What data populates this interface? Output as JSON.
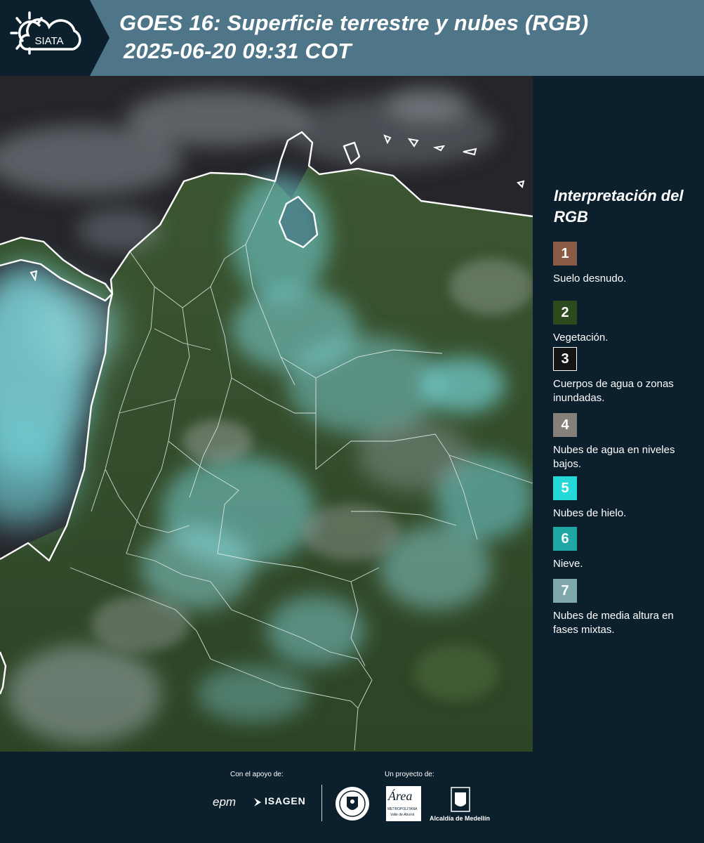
{
  "header": {
    "logo_text": "SIATA",
    "title_line1": "GOES 16: Superficie terrestre y nubes (RGB)",
    "title_line2": "2025-06-20 09:31 COT"
  },
  "legend": {
    "title": "Interpretación del RGB",
    "items": [
      {
        "number": "1",
        "label": "Suelo desnudo.",
        "color": "#8a5b45"
      },
      {
        "number": "2",
        "label": "Vegetación.",
        "color": "#2b4a1e"
      },
      {
        "number": "3",
        "label": "Cuerpos de agua o zonas inundadas.",
        "color": "#141414"
      },
      {
        "number": "4",
        "label": "Nubes de agua en niveles bajos.",
        "color": "#86807a"
      },
      {
        "number": "5",
        "label": "Nubes de hielo.",
        "color": "#25d9d9"
      },
      {
        "number": "6",
        "label": "Nieve.",
        "color": "#21a6a6"
      },
      {
        "number": "7",
        "label": "Nubes de media altura en fases mixtas.",
        "color": "#7fa8aa"
      }
    ]
  },
  "footer": {
    "support_label": "Con el apoyo de:",
    "project_label": "Un proyecto de:",
    "sponsors": [
      "epm",
      "ISAGEN"
    ],
    "partners": [
      "Medellín",
      "Área Metropolitana Valle de Aburrá",
      "Alcaldía de Medellín"
    ],
    "area_logo_text": "Área",
    "area_sub": "METROPOLITANA",
    "area_sub2": "Valle de Aburrá",
    "alcaldia_text": "Alcaldía de Medellín"
  },
  "colors": {
    "background": "#0c1f2c",
    "header_band": "#4f7688",
    "ice_cloud": "#6fdce2",
    "vegetation": "#35512a"
  }
}
